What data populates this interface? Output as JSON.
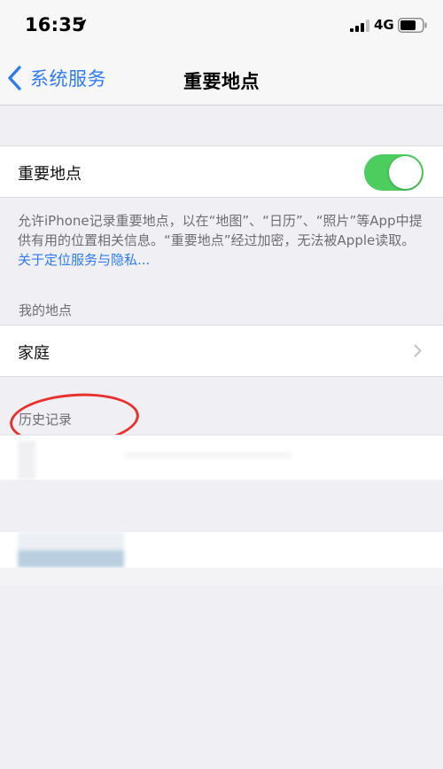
{
  "status_bar": {
    "time": "16:35",
    "network": "4G",
    "icons": [
      "location-arrow-icon",
      "signal-icon",
      "battery-icon"
    ]
  },
  "nav": {
    "back_label": "系统服务",
    "title": "重要地点",
    "back_icon": "chevron-left-icon"
  },
  "toggle": {
    "label": "重要地点",
    "enabled": true,
    "on_color": "#4ccd5e"
  },
  "footer": {
    "text": "允许iPhone记录重要地点，以在“地图”、“日历”、“照片”等App中提供有用的位置相关信息。“重要地点”经过加密，无法被Apple读取。",
    "link": "关于定位服务与隐私..."
  },
  "my_places": {
    "header": "我的地点",
    "items": [
      {
        "label": "家庭",
        "icon": "chevron-right-icon"
      }
    ]
  },
  "history": {
    "header": "历史记录"
  },
  "colors": {
    "accent": "#2f7bf5",
    "background": "#efeff4",
    "annotation": "#e8302d"
  }
}
